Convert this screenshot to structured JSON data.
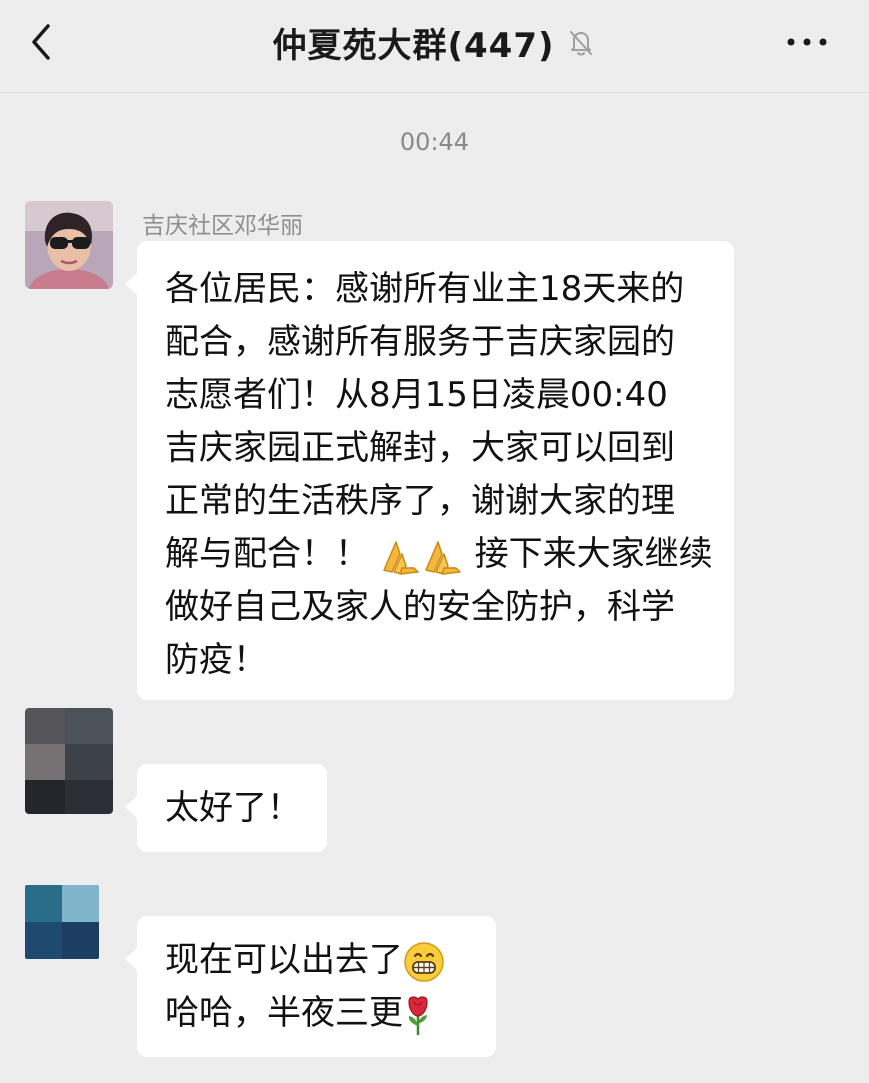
{
  "header": {
    "title": "仲夏苑大群(447)",
    "back_icon": "chevron-left-icon",
    "mute_icon": "bell-off-icon",
    "more_icon": "more-dots-icon"
  },
  "chat": {
    "timestamp": "00:44",
    "messages": [
      {
        "sender": "吉庆社区邓华丽",
        "lines": [
          "各位居民：感谢所有业主18天来的",
          "配合，感谢所有服务于吉庆家园的",
          "志愿者们！从8月15日凌晨00:40",
          "吉庆家园正式解封，大家可以回到",
          "正常的生活秩序了，谢谢大家的理"
        ],
        "line6_before": "解与配合！！",
        "line6_after": "接下来大家继续",
        "lines_end": [
          "做好自己及家人的安全防护，科学",
          "防疫！"
        ],
        "emoji": "folded-hands-icon"
      },
      {
        "sender": "",
        "text": "太好了！"
      },
      {
        "sender": "",
        "line1": "现在可以出去了",
        "line2": "哈哈，半夜三更",
        "emoji1": "grinning-face-icon",
        "emoji2": "rose-icon"
      }
    ]
  },
  "colors": {
    "background": "#ededed",
    "bubble": "#ffffff",
    "text": "#111111",
    "meta_text": "#8f8f8f"
  }
}
